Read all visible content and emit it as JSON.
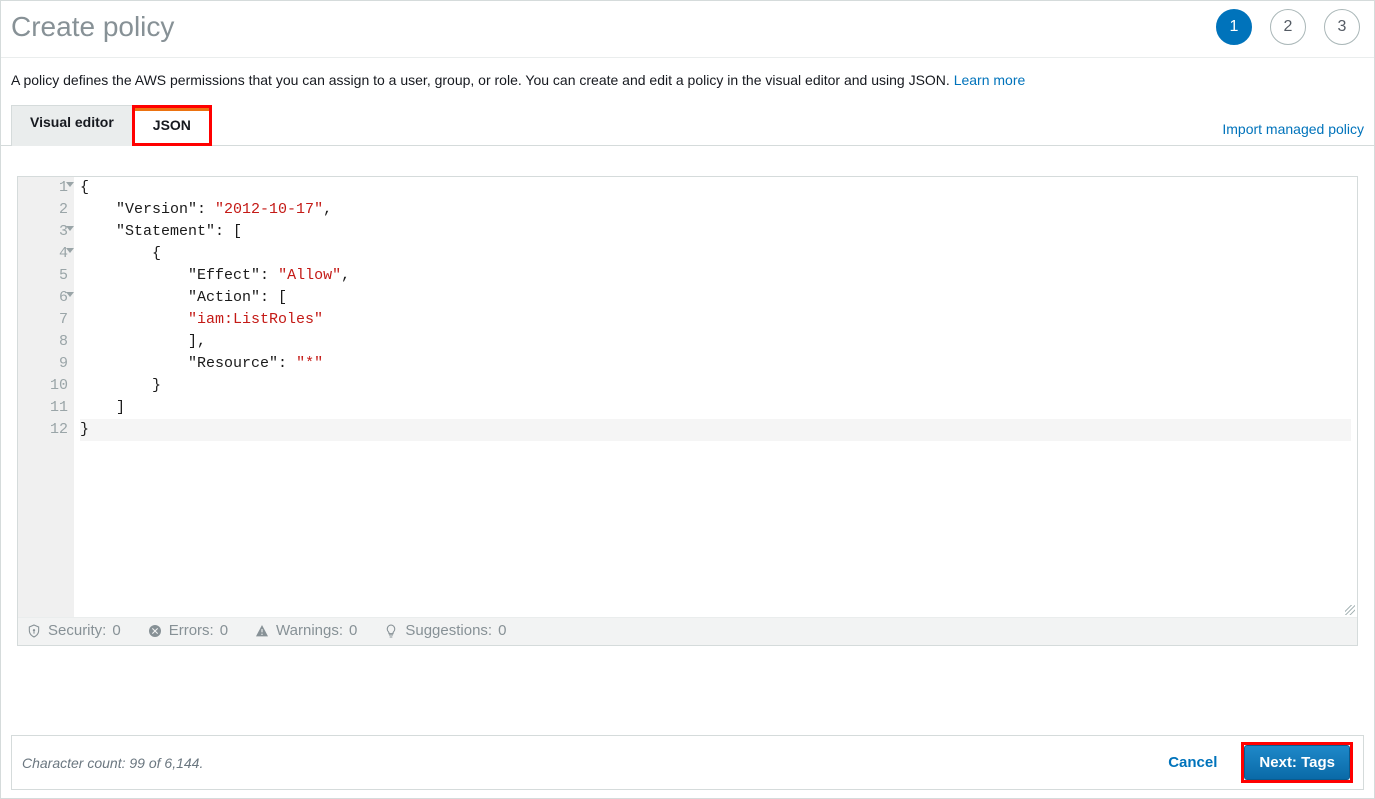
{
  "header": {
    "title": "Create policy",
    "steps": [
      "1",
      "2",
      "3"
    ],
    "active_step_index": 0
  },
  "description": {
    "text": "A policy defines the AWS permissions that you can assign to a user, group, or role. You can create and edit a policy in the visual editor and using JSON.",
    "learn_more": "Learn more"
  },
  "tabs": {
    "visual_editor": "Visual editor",
    "json": "JSON",
    "import_link": "Import managed policy"
  },
  "editor": {
    "line_numbers": [
      "1",
      "2",
      "3",
      "4",
      "5",
      "6",
      "7",
      "8",
      "9",
      "10",
      "11",
      "12"
    ],
    "foldable_lines": [
      1,
      3,
      4,
      6
    ],
    "lines": [
      {
        "indent": 0,
        "tokens": [
          {
            "t": "{",
            "c": "punc"
          }
        ]
      },
      {
        "indent": 1,
        "tokens": [
          {
            "t": "\"Version\"",
            "c": "key"
          },
          {
            "t": ": ",
            "c": "punc"
          },
          {
            "t": "\"2012-10-17\"",
            "c": "str"
          },
          {
            "t": ",",
            "c": "punc"
          }
        ]
      },
      {
        "indent": 1,
        "tokens": [
          {
            "t": "\"Statement\"",
            "c": "key"
          },
          {
            "t": ": [",
            "c": "punc"
          }
        ]
      },
      {
        "indent": 2,
        "tokens": [
          {
            "t": "{",
            "c": "punc"
          }
        ]
      },
      {
        "indent": 3,
        "tokens": [
          {
            "t": "\"Effect\"",
            "c": "key"
          },
          {
            "t": ": ",
            "c": "punc"
          },
          {
            "t": "\"Allow\"",
            "c": "str"
          },
          {
            "t": ",",
            "c": "punc"
          }
        ]
      },
      {
        "indent": 3,
        "tokens": [
          {
            "t": "\"Action\"",
            "c": "key"
          },
          {
            "t": ": [",
            "c": "punc"
          }
        ]
      },
      {
        "indent": 3,
        "tokens": [
          {
            "t": "\"iam:ListRoles\"",
            "c": "str"
          }
        ]
      },
      {
        "indent": 3,
        "tokens": [
          {
            "t": "],",
            "c": "punc"
          }
        ]
      },
      {
        "indent": 3,
        "tokens": [
          {
            "t": "\"Resource\"",
            "c": "key"
          },
          {
            "t": ": ",
            "c": "punc"
          },
          {
            "t": "\"*\"",
            "c": "str"
          }
        ]
      },
      {
        "indent": 2,
        "tokens": [
          {
            "t": "}",
            "c": "punc"
          }
        ]
      },
      {
        "indent": 1,
        "tokens": [
          {
            "t": "]",
            "c": "punc"
          }
        ]
      },
      {
        "indent": 0,
        "tokens": [
          {
            "t": "}",
            "c": "punc"
          }
        ],
        "cursor": true
      }
    ]
  },
  "status": {
    "security_label": "Security:",
    "security_count": "0",
    "errors_label": "Errors:",
    "errors_count": "0",
    "warnings_label": "Warnings:",
    "warnings_count": "0",
    "suggestions_label": "Suggestions:",
    "suggestions_count": "0"
  },
  "footer": {
    "char_count": "Character count: 99 of 6,144.",
    "cancel": "Cancel",
    "next": "Next: Tags"
  }
}
